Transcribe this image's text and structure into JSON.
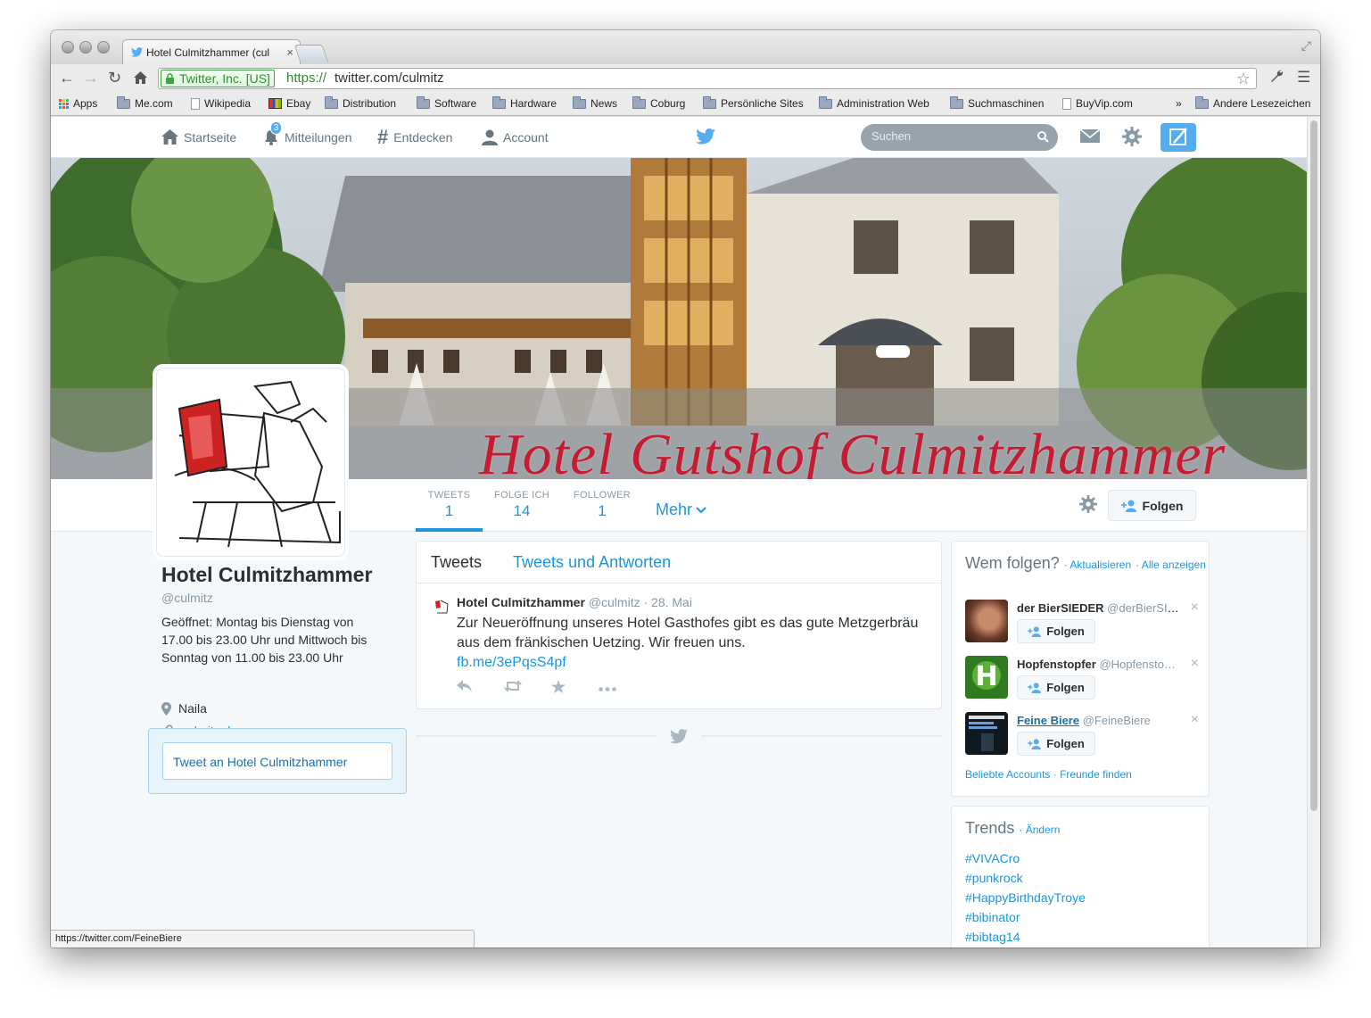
{
  "browser": {
    "tab_title": "Hotel Culmitzhammer (cul",
    "tab_close": "×",
    "ev_badge": "Twitter, Inc. [US]",
    "url_scheme": "https://",
    "url_rest": "twitter.com/culmitz",
    "status_url": "https://twitter.com/FeineBiere",
    "bookmarks": [
      {
        "label": "Apps",
        "icon": "apps-grid-icon"
      },
      {
        "label": "Me.com",
        "icon": "folder-icon"
      },
      {
        "label": "Wikipedia",
        "icon": "page-icon"
      },
      {
        "label": "Ebay",
        "icon": "ebay-icon"
      },
      {
        "label": "Distribution",
        "icon": "folder-icon"
      },
      {
        "label": "Software",
        "icon": "folder-icon"
      },
      {
        "label": "Hardware",
        "icon": "folder-icon"
      },
      {
        "label": "News",
        "icon": "folder-icon"
      },
      {
        "label": "Coburg",
        "icon": "folder-icon"
      },
      {
        "label": "Persönliche Sites",
        "icon": "folder-icon"
      },
      {
        "label": "Administration Web",
        "icon": "folder-icon"
      },
      {
        "label": "Suchmaschinen",
        "icon": "folder-icon"
      },
      {
        "label": "BuyVip.com",
        "icon": "page-icon"
      }
    ],
    "bookmarks_overflow": "»",
    "other_bookmarks": "Andere Lesezeichen"
  },
  "topnav": {
    "home": "Startseite",
    "notifications": "Mitteilungen",
    "notifications_count": "3",
    "discover": "Entdecken",
    "account": "Account",
    "search_placeholder": "Suchen"
  },
  "banner": {
    "text": "Hotel Gutshof Culmitzhammer"
  },
  "profile": {
    "name": "Hotel Culmitzhammer",
    "handle": "@culmitz",
    "bio": "Geöffnet: Montag bis Dienstag von 17.00 bis 23.00 Uhr und Mittwoch bis Sonntag von 11.00 bis 23.00 Uhr",
    "location": "Naila",
    "website": "culmitz.de",
    "tweet_to": "Tweet an Hotel Culmitzhammer"
  },
  "stats": [
    {
      "label": "TWEETS",
      "value": "1"
    },
    {
      "label": "FOLGE ICH",
      "value": "14"
    },
    {
      "label": "FOLLOWER",
      "value": "1"
    }
  ],
  "more_label": "Mehr",
  "follow_label": "Folgen",
  "timeline": {
    "tab_tweets": "Tweets",
    "tab_replies": "Tweets und Antworten",
    "tweet": {
      "author": "Hotel Culmitzhammer",
      "handle": "@culmitz",
      "date": "· 28. Mai",
      "text": "Zur Neueröffnung unseres Hotel Gasthofes gibt es das gute Metzgerbräu aus dem fränkischen Uetzing. Wir freuen uns.",
      "link": "fb.me/3ePqsS4pf"
    }
  },
  "who_to_follow": {
    "title": "Wem folgen?",
    "refresh": "· Aktualisieren",
    "show_all": "· Alle anzeigen",
    "suggestions": [
      {
        "name": "der BierSIEDER",
        "handle": "@derBierSIE…",
        "follow": "Folgen"
      },
      {
        "name": "Hopfenstopfer",
        "handle": "@Hopfensto…",
        "follow": "Folgen"
      },
      {
        "name": "Feine Biere",
        "handle": "@FeineBiere",
        "follow": "Folgen"
      }
    ],
    "popular": "Beliebte Accounts",
    "find_friends": "· Freunde finden"
  },
  "trends": {
    "title": "Trends",
    "change": "· Ändern",
    "items": [
      "#VIVACro",
      "#punkrock",
      "#HappyBirthdayTroye",
      "#bibinator",
      "#bibtag14"
    ]
  },
  "colors": {
    "twitter_blue": "#55acee",
    "link_blue": "#1b95e0",
    "banner_red": "#c41c32"
  }
}
